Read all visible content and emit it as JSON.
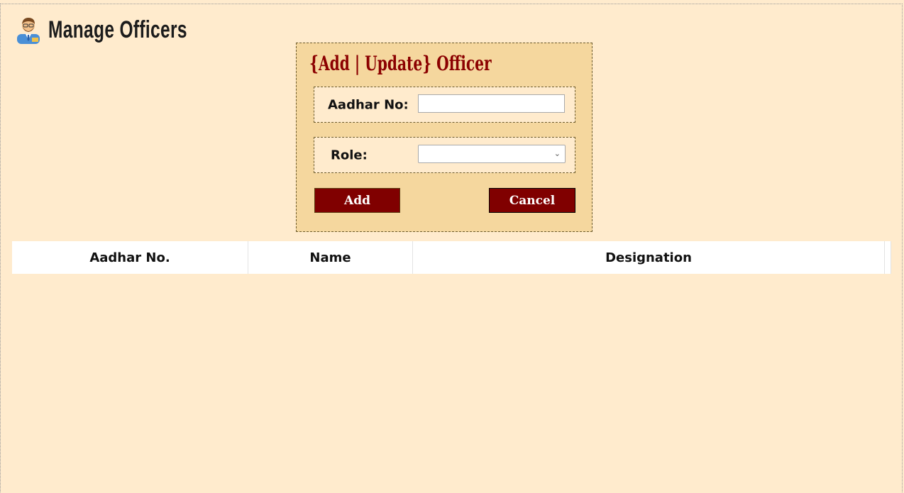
{
  "header": {
    "title": "Manage Officers",
    "icon": "officer-avatar-icon"
  },
  "form": {
    "title": "{Add | Update} Officer",
    "aadhar_label": "Aadhar No:",
    "aadhar_value": "",
    "role_label": "Role:",
    "role_selected": "",
    "add_label": "Add",
    "cancel_label": "Cancel"
  },
  "table": {
    "columns": [
      "Aadhar No.",
      "Name",
      "Designation"
    ],
    "rows": []
  },
  "colors": {
    "background": "#ffebcd",
    "form_background": "#f5d79e",
    "accent": "#800000"
  }
}
